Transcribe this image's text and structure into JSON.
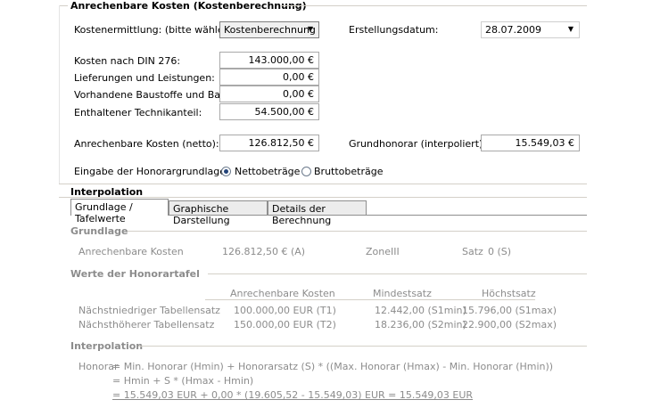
{
  "header": {
    "title": "Anrechenbare Kosten (Kostenberechnung)"
  },
  "form": {
    "cost_method_label": "Kostenermittlung: (bitte wählen Sie)",
    "cost_method_value": "Kostenberechnung",
    "date_label": "Erstellungsdatum:",
    "date_value": "28.07.2009",
    "rows": [
      {
        "label": "Kosten nach DIN 276:",
        "value": "143.000,00 €"
      },
      {
        "label": "Lieferungen und Leistungen:",
        "value": "0,00 €"
      },
      {
        "label": "Vorhandene Baustoffe und Bauteile:",
        "value": "0,00 €"
      },
      {
        "label": "Enthaltener Technikanteil:",
        "value": "54.500,00 €"
      }
    ],
    "net_label": "Anrechenbare Kosten (netto):",
    "net_value": "126.812,50 €",
    "grundhonorar_label": "Grundhonorar (interpoliert)",
    "grundhonorar_value": "15.549,03 €",
    "basis_label": "Eingabe der Honorargrundlage:",
    "radio_net": "Nettobeträge",
    "radio_gross": "Bruttobeträge"
  },
  "interpolation": {
    "title": "Interpolation",
    "tabs": [
      "Grundlage / Tafelwerte",
      "Graphische Darstellung",
      "Details der Berechnung"
    ],
    "grundlage_title": "Grundlage",
    "grundlage_label": "Anrechenbare Kosten",
    "grundlage_value": "126.812,50 € (A)",
    "zone_label": "Zone",
    "zone_value": "III",
    "satz_label": "Satz",
    "satz_value": "0 (S)",
    "werte_title": "Werte der Honorartafel",
    "table_headers": [
      "Anrechenbare Kosten",
      "Mindestsatz",
      "Höchstsatz"
    ],
    "table_rows": [
      {
        "label": "Nächstniedriger Tabellensatz",
        "kosten": "100.000,00 EUR (T1)",
        "min": "12.442,00 (S1min)",
        "max": "15.796,00 (S1max)"
      },
      {
        "label": "Nächsthöherer Tabellensatz",
        "kosten": "150.000,00 EUR (T2)",
        "min": "18.236,00 (S2min)",
        "max": "22.900,00 (S2max)"
      }
    ],
    "interp_title": "Interpolation",
    "formula_label": "Honorar",
    "formula_line1": "= Min. Honorar (Hmin) + Honorarsatz (S) * ((Max. Honorar (Hmax) - Min. Honorar (Hmin))",
    "formula_line2": "= Hmin + S * (Hmax - Hmin)",
    "formula_line3": "= 15.549,03 EUR + 0,00 * (19.605,52 - 15.549,03) EUR = 15.549,03 EUR"
  }
}
